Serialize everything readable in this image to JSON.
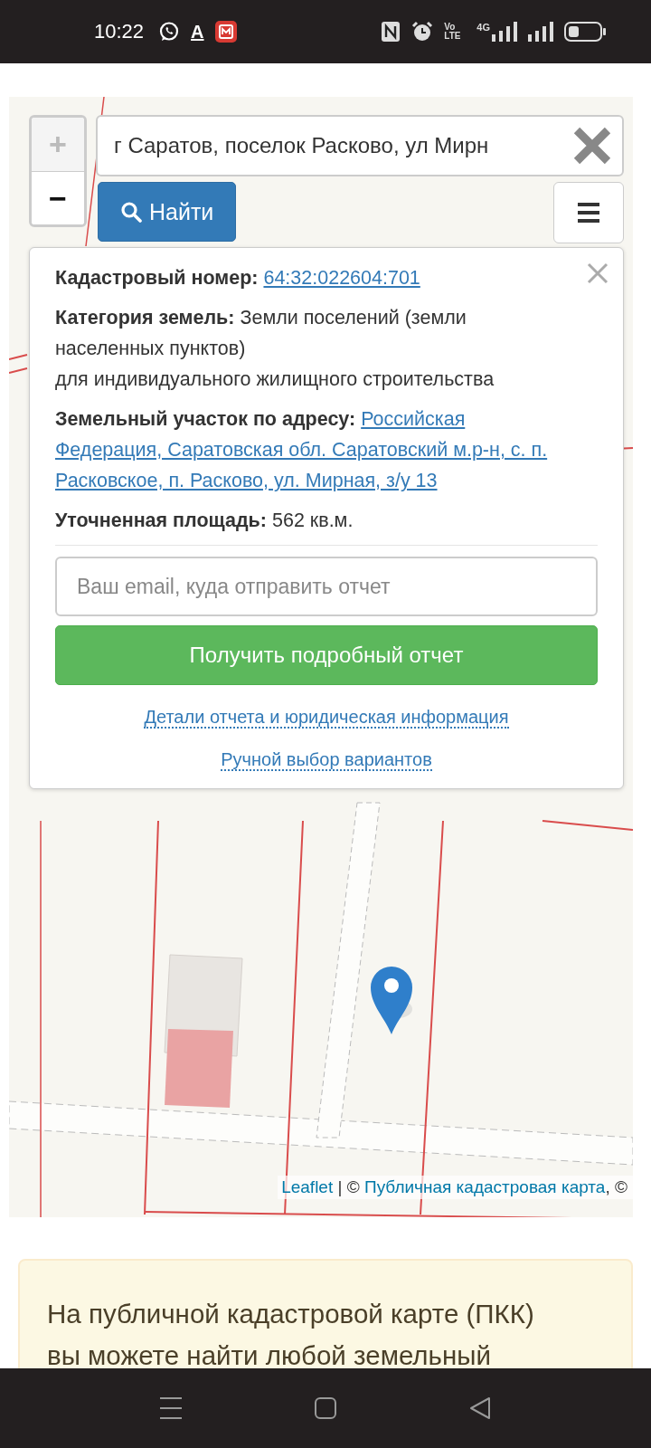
{
  "status_bar": {
    "time": "10:22",
    "app_letter": "A",
    "volte_label": "Vo LTE",
    "network_label": "4G"
  },
  "map": {
    "zoom_controls": [
      {
        "label": "+",
        "disabled": true
      },
      {
        "label": "−",
        "disabled": false
      }
    ],
    "search": {
      "value": "г Саратов, поселок Расково, ул Мирн"
    },
    "find_button": {
      "label": "Найти"
    },
    "popup": {
      "fields": [
        {
          "kind": "link",
          "label": "Кадастровый номер:",
          "value": "64:32:022604:701"
        },
        {
          "kind": "text",
          "label": "Категория земель:",
          "value": "Земли поселений (земли населенных пунктов)",
          "note": "для индивидуального жилищного строительства"
        },
        {
          "kind": "link",
          "label": "Земельный участок по адресу:",
          "value": "Российская Федерация, Саратовская обл. Саратовский м.р-н, с. п. Расковское, п. Расково, ул. Мирная, з/у 13"
        },
        {
          "kind": "text",
          "label": "Уточненная площадь:",
          "value": "562 кв.м."
        }
      ],
      "email": {
        "placeholder": "Ваш email, куда отправить отчет"
      },
      "submit": {
        "label": "Получить подробный отчет"
      },
      "links": [
        "Детали отчета и юридическая информация",
        "Ручной выбор вариантов"
      ]
    },
    "attribution": [
      {
        "kind": "link",
        "text": "Leaflet"
      },
      {
        "kind": "text",
        "text": " | © "
      },
      {
        "kind": "link",
        "text": "Публичная кадастровая карта"
      },
      {
        "kind": "text",
        "text": ", ©"
      }
    ]
  },
  "info": {
    "text": "На публичной кадастровой карте (ПКК) вы можете найти любой земельный"
  }
}
